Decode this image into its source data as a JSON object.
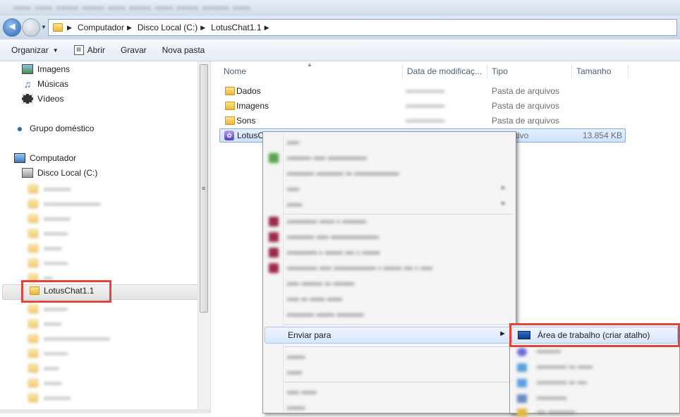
{
  "address": {
    "crumbs": [
      "Computador",
      "Disco Local (C:)",
      "LotusChat1.1"
    ]
  },
  "toolbar": {
    "organize": "Organizar",
    "open": "Abrir",
    "burn": "Gravar",
    "new_folder": "Nova pasta"
  },
  "nav": {
    "libraries": [
      "Imagens",
      "Músicas",
      "Vídeos"
    ],
    "homegroup": "Grupo doméstico",
    "computer": "Computador",
    "drive": "Disco Local (C:)",
    "selected_folder": "LotusChat1.1"
  },
  "columns": {
    "name": "Nome",
    "date": "Data de modificaç...",
    "type": "Tipo",
    "size": "Tamanho"
  },
  "files": [
    {
      "name": "Dados",
      "type": "Pasta de arquivos",
      "size": ""
    },
    {
      "name": "Imagens",
      "type": "Pasta de arquivos",
      "size": ""
    },
    {
      "name": "Sons",
      "type": "Pasta de arquivos",
      "size": ""
    },
    {
      "name": "LotusCh",
      "type": "Aplicativo",
      "size": "13.854 KB"
    }
  ],
  "context_menu": {
    "send_to": "Enviar para"
  },
  "submenu": {
    "desktop_shortcut": "Área de trabalho (criar atalho)"
  },
  "colors": {
    "highlight_box": "#e2453c",
    "selection_bg": "#d8e7fb"
  }
}
